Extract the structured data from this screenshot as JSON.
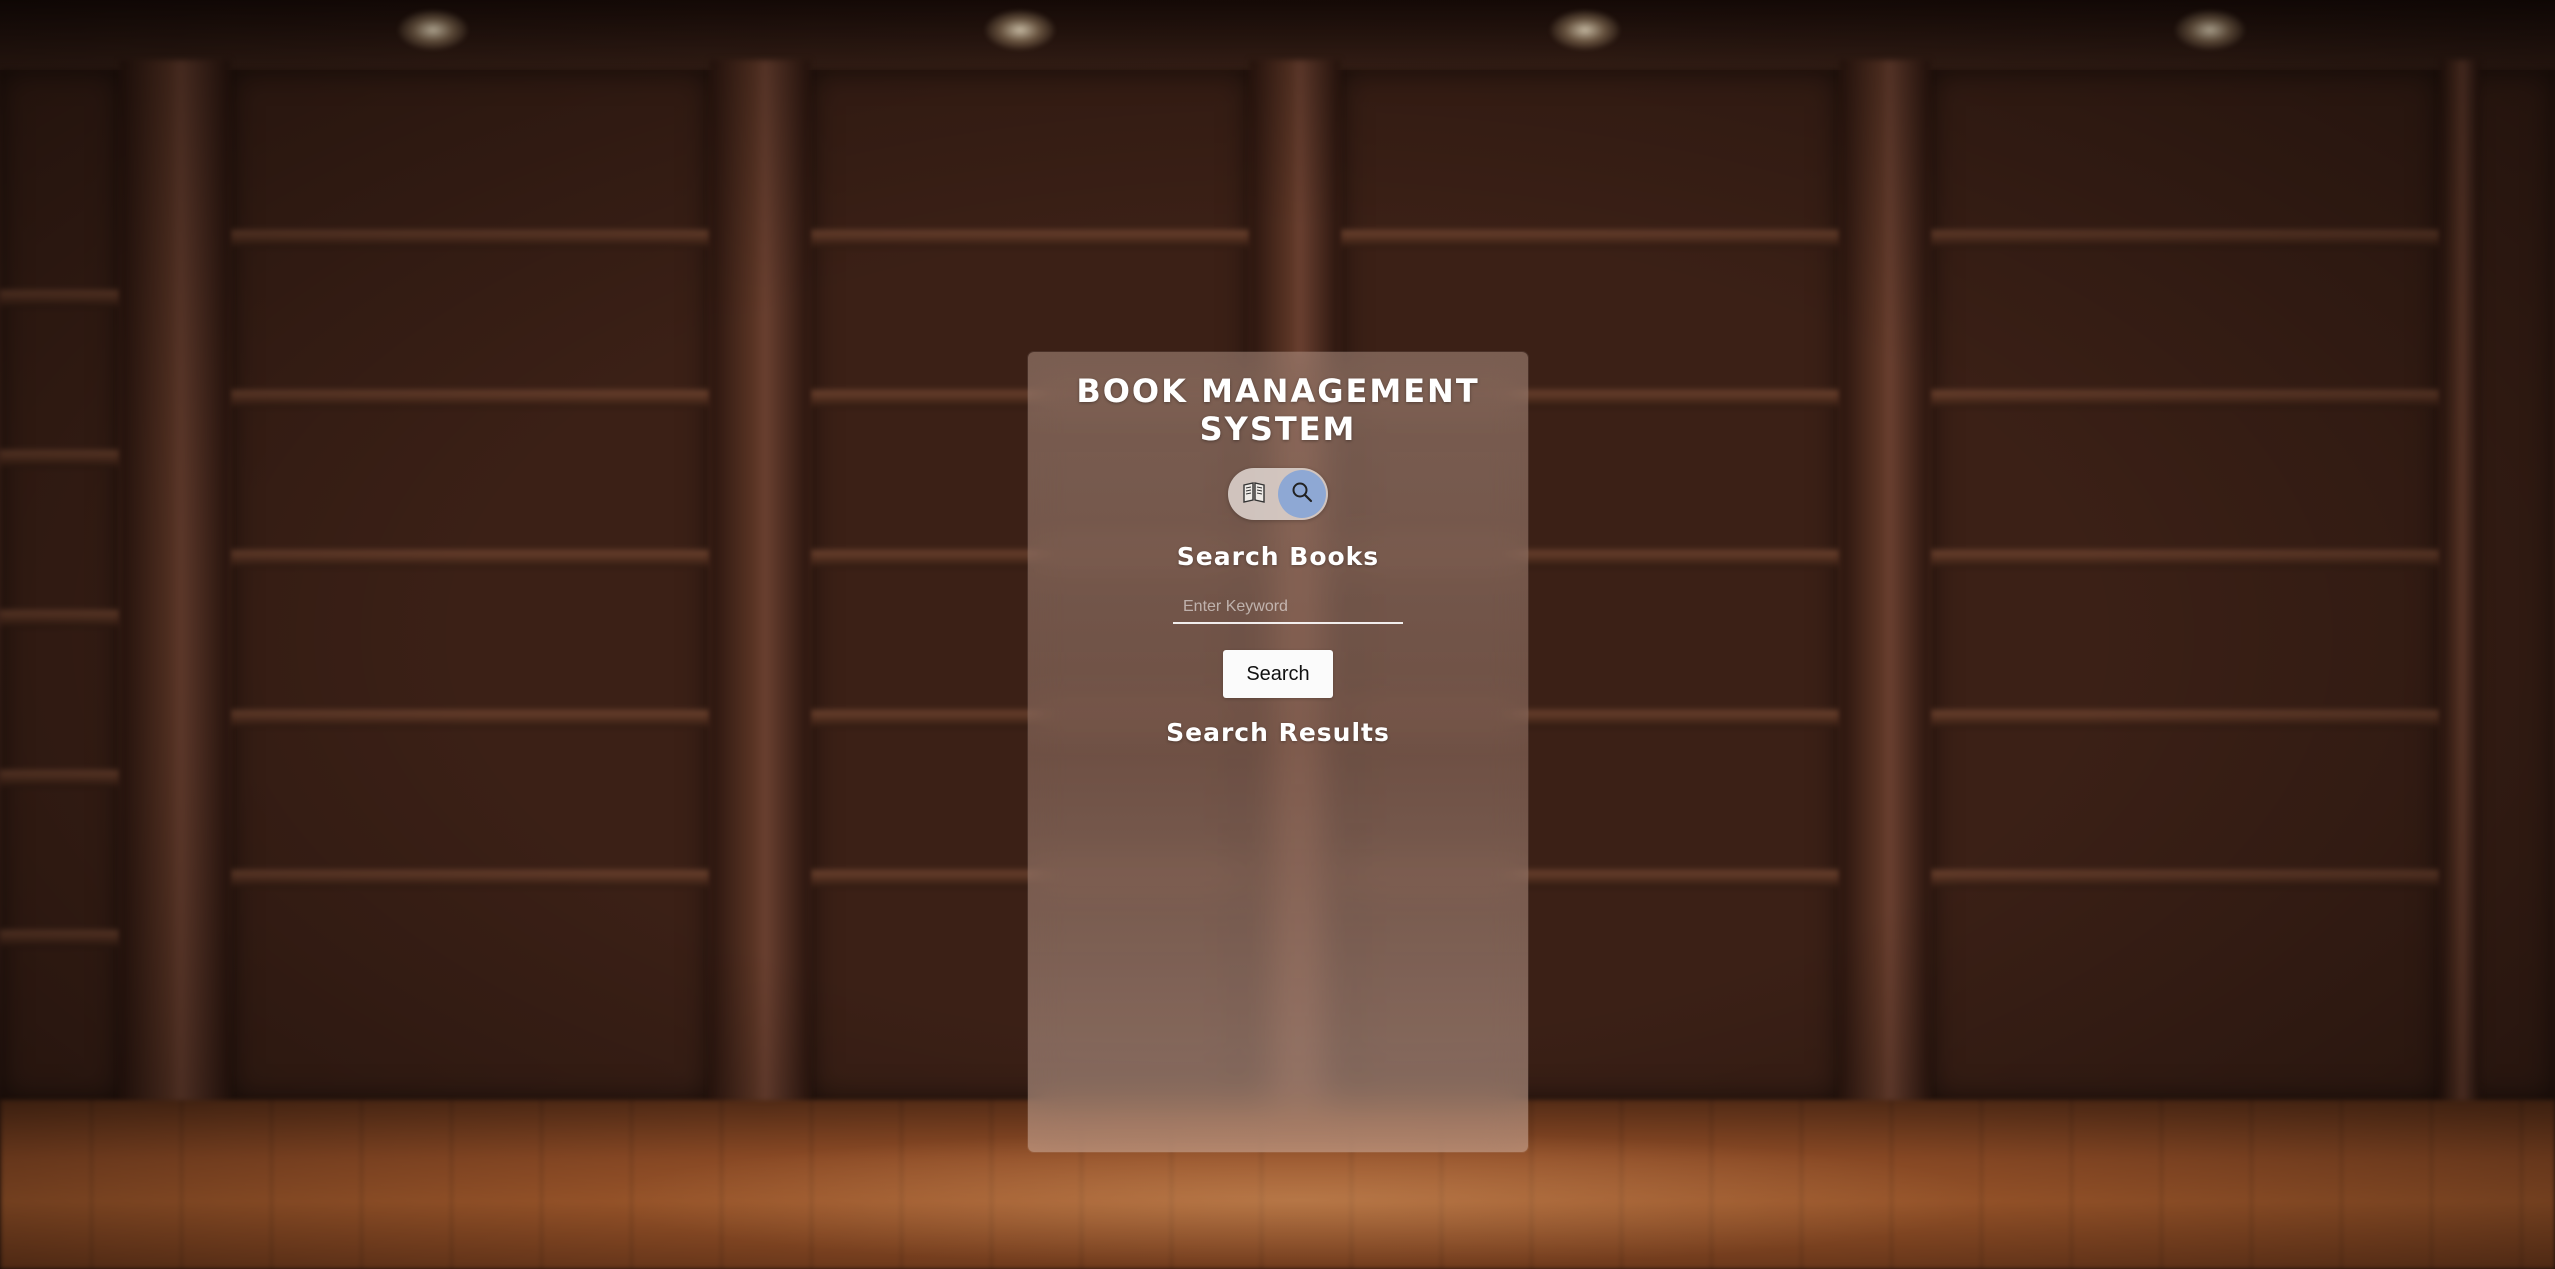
{
  "app": {
    "title": "BOOK MANAGEMENT SYSTEM"
  },
  "mode_toggle": {
    "options": [
      {
        "icon": "book-icon",
        "selected": false
      },
      {
        "icon": "search-icon",
        "selected": true
      }
    ],
    "active_color": "#8ea8d4"
  },
  "search": {
    "heading": "Search Books",
    "placeholder": "Enter Keyword",
    "value": "",
    "button_label": "Search"
  },
  "results": {
    "heading": "Search Results",
    "items": []
  }
}
